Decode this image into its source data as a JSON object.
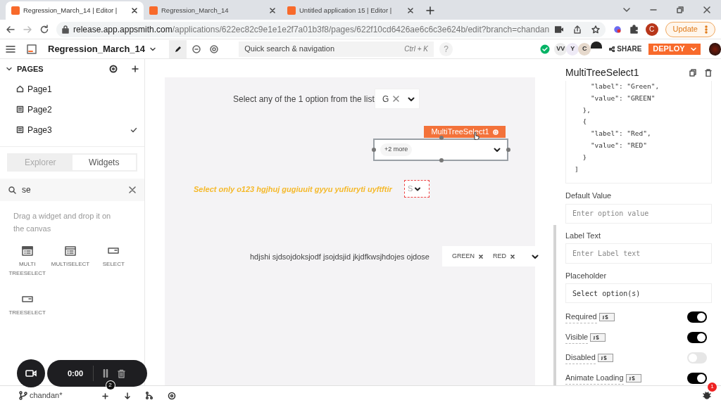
{
  "browser": {
    "tabs": [
      {
        "title": "Regression_March_14 | Editor |",
        "selected": true
      },
      {
        "title": "Regression_March_14",
        "selected": false
      },
      {
        "title": "Untitled application 15 | Editor |",
        "selected": false
      }
    ],
    "url_host": "release.app.appsmith.com",
    "url_path": "/applications/622ec82c9e1e1e2f7a01b3f8/pages/622f10cd6426ae6c6c3e624b/edit?branch=chandan",
    "profile": "C",
    "update_button": "Update"
  },
  "header": {
    "app_name": "Regression_March_14",
    "search": {
      "placeholder": "Quick search & navigation",
      "shortcut": "Ctrl + K"
    },
    "help": "?",
    "avatars": [
      "VV",
      "Y",
      "C"
    ],
    "share": "SHARE",
    "deploy": "DEPLOY"
  },
  "sidebar": {
    "pages_title": "PAGES",
    "pages": [
      {
        "name": "Page1",
        "kind": "home",
        "selected": false
      },
      {
        "name": "Page2",
        "kind": "page",
        "selected": false
      },
      {
        "name": "Page3",
        "kind": "page",
        "selected": true
      }
    ],
    "tabs": [
      {
        "label": "Explorer",
        "selected": false
      },
      {
        "label": "Widgets",
        "selected": true
      }
    ],
    "search": {
      "value": "se"
    },
    "hint": "Drag a widget and drop it on the canvas",
    "widgets": [
      {
        "label": "MULTI TREESELECT",
        "kind": "multitree"
      },
      {
        "label": "MULTISELECT",
        "kind": "multi"
      },
      {
        "label": "SELECT",
        "kind": "select"
      },
      {
        "label": "TREESELECT",
        "kind": "tree"
      }
    ]
  },
  "canvas": {
    "widgets": [
      {
        "kind": "single",
        "label": "Select any of the 1 option from the list",
        "value": "G"
      },
      {
        "kind": "selected",
        "name": "MultiTreeSelect1",
        "tag": "+2 more"
      },
      {
        "kind": "error",
        "label": "Select only o123 hgjhuj gugiuuit gyyu yufiuryti uyftftir",
        "placeholder": "S"
      },
      {
        "kind": "tags",
        "label": "hdjshi sjdsojdoksjodf jsojdsjid jkjdfkwsjhdojes ojdose",
        "tags": [
          "GREEN",
          "RED"
        ]
      }
    ]
  },
  "recorder": {
    "time": "0:00"
  },
  "bottom_bar": {
    "branch": "chandan*",
    "badge": "2"
  },
  "properties": {
    "title": "MultiTreeSelect1",
    "code": [
      "    \"label\": \"Green\",",
      "    \"value\": \"GREEN\"",
      "  },",
      "  {",
      "    \"label\": \"Red\",",
      "    \"value\": \"RED\"",
      "  }",
      "]"
    ],
    "fields": [
      {
        "label": "Default Value",
        "placeholder": "Enter option value"
      },
      {
        "label": "Label Text",
        "placeholder": "Enter Label text"
      },
      {
        "label": "Placeholder",
        "value": "Select option(s)"
      }
    ],
    "toggles": [
      {
        "label": "Required",
        "on": true
      },
      {
        "label": "Visible",
        "on": true
      },
      {
        "label": "Disabled",
        "on": false
      },
      {
        "label": "Animate Loading",
        "on": true
      }
    ],
    "debug_badge": "1"
  }
}
